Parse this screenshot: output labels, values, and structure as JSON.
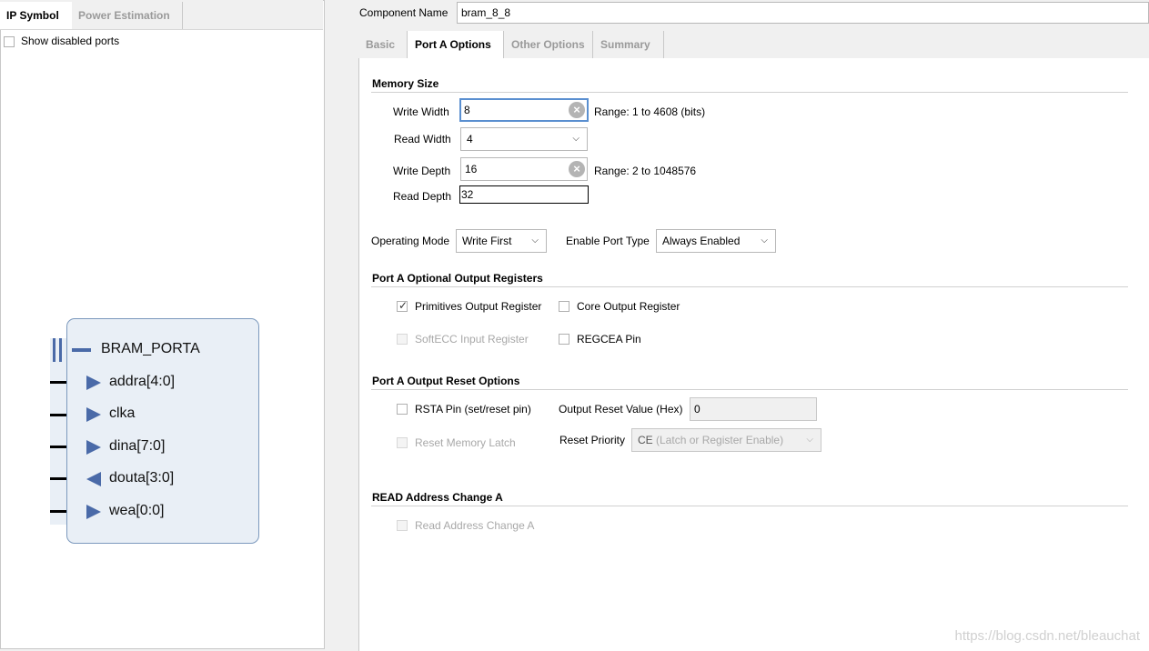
{
  "left": {
    "tabs": [
      "IP Symbol",
      "Power Estimation"
    ],
    "show_disabled_ports": "Show disabled ports",
    "symbol": {
      "bus_name": "BRAM_PORTA",
      "ports": [
        "addra[4:0]",
        "clka",
        "dina[7:0]",
        "douta[3:0]",
        "wea[0:0]"
      ]
    }
  },
  "component": {
    "label": "Component Name",
    "value": "bram_8_8"
  },
  "tabs": [
    "Basic",
    "Port A Options",
    "Other Options",
    "Summary"
  ],
  "memory_size": {
    "title": "Memory Size",
    "write_width_label": "Write Width",
    "write_width": "8",
    "write_width_range": "Range: 1 to 4608 (bits)",
    "read_width_label": "Read Width",
    "read_width": "4",
    "write_depth_label": "Write Depth",
    "write_depth": "16",
    "write_depth_range": "Range: 2 to 1048576",
    "read_depth_label": "Read Depth",
    "read_depth": "32"
  },
  "operating_mode": {
    "label": "Operating Mode",
    "value": "Write First"
  },
  "enable_port_type": {
    "label": "Enable Port Type",
    "value": "Always Enabled"
  },
  "optional_output": {
    "title": "Port A Optional Output Registers",
    "primitives": "Primitives Output Register",
    "core": "Core Output Register",
    "softecc": "SoftECC Input Register",
    "regcea": "REGCEA Pin"
  },
  "reset": {
    "title": "Port A Output Reset Options",
    "rsta": "RSTA Pin (set/reset pin)",
    "output_reset_label": "Output Reset Value (Hex)",
    "output_reset_value": "0",
    "reset_memory_latch": "Reset Memory Latch",
    "reset_priority_label": "Reset Priority",
    "reset_priority_value_a": "CE",
    "reset_priority_value_b": "(Latch or Register Enable)"
  },
  "read_address": {
    "title": "READ Address Change A",
    "option": "Read Address Change A"
  },
  "watermark": "https://blog.csdn.net/bleauchat",
  "colors": {
    "accent": "#5a8fd0",
    "symbol_fill": "#e9eff6",
    "symbol_arrow": "#4a6aa8"
  }
}
